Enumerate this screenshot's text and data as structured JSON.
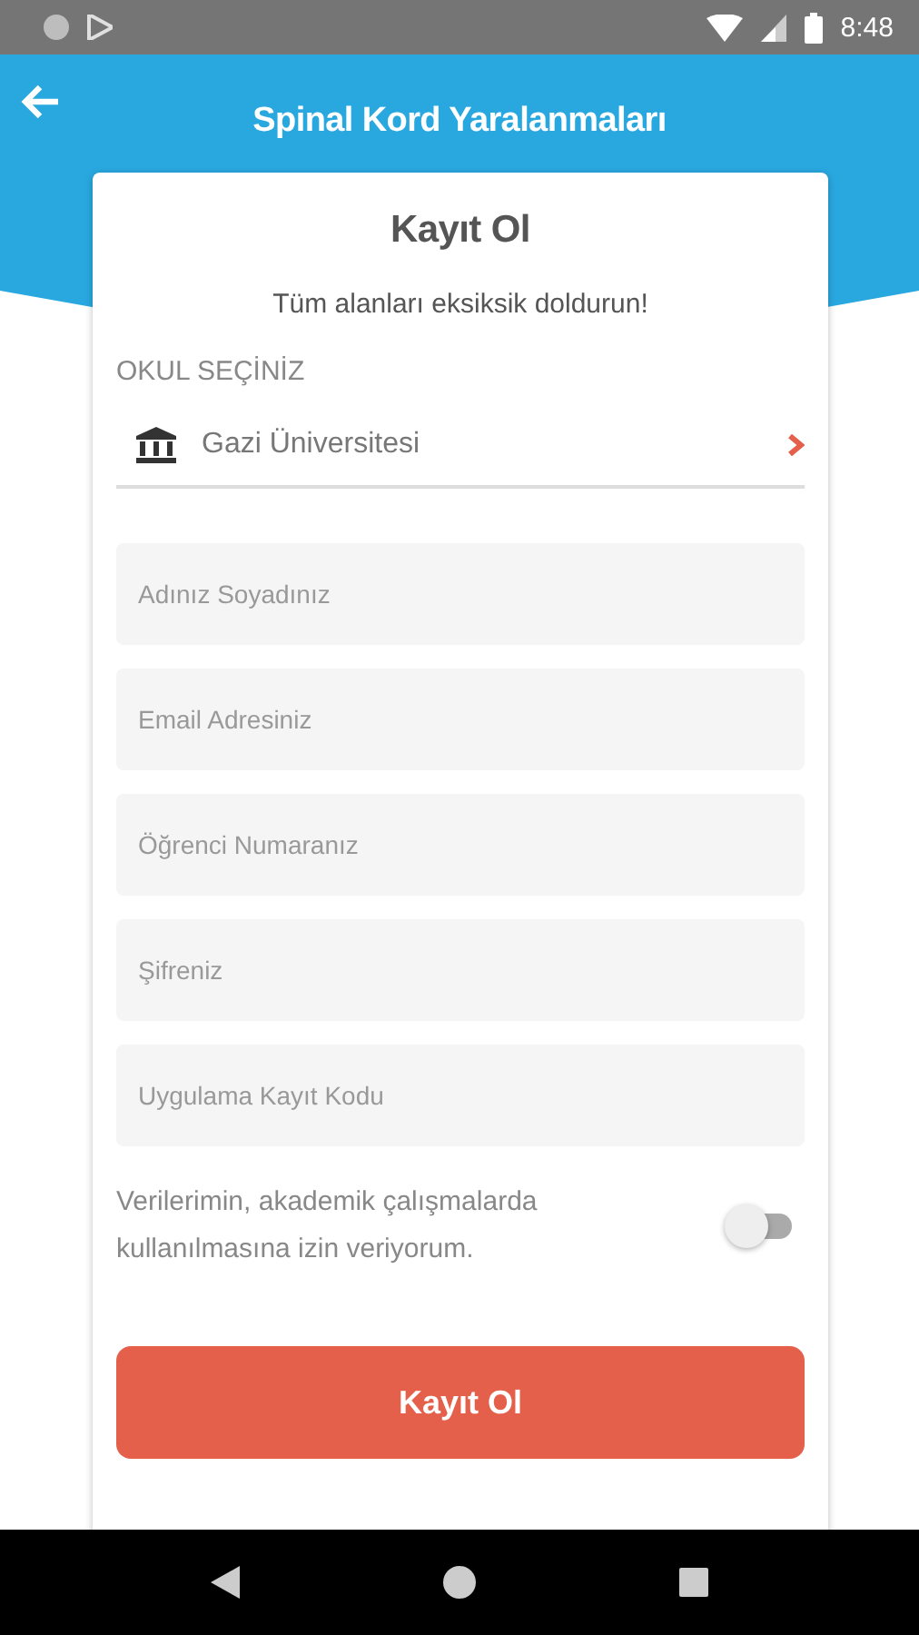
{
  "status_bar": {
    "time": "8:48"
  },
  "app_bar": {
    "title": "Spinal Kord Yaralanmaları"
  },
  "card": {
    "title": "Kayıt Ol",
    "subtitle": "Tüm alanları eksiksik doldurun!",
    "school": {
      "label": "OKUL SEÇİNİZ",
      "value": "Gazi Üniversitesi"
    },
    "fields": [
      {
        "placeholder": "Adınız Soyadınız"
      },
      {
        "placeholder": "Email Adresiniz"
      },
      {
        "placeholder": "Öğrenci Numaranız"
      },
      {
        "placeholder": "Şifreniz"
      },
      {
        "placeholder": "Uygulama Kayıt Kodu"
      }
    ],
    "consent": {
      "text": "Verilerimin, akademik çalışmalarda kullanılmasına izin veriyorum.",
      "on": false
    },
    "submit": "Kayıt Ol"
  }
}
